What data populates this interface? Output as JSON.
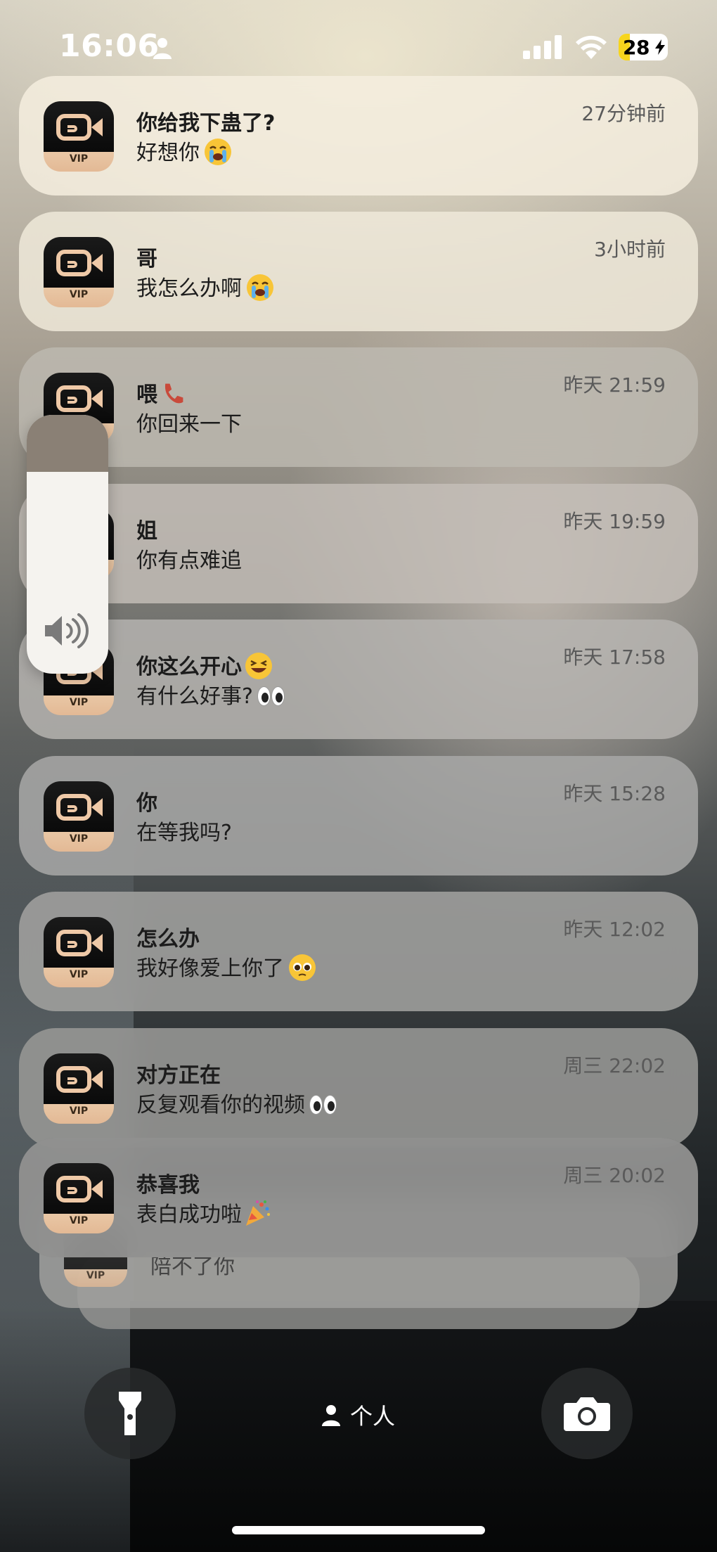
{
  "status_bar": {
    "time": "16:06",
    "battery": "28"
  },
  "notifications": [
    {
      "title": "你给我下蛊了?",
      "body": "好想你",
      "emoji": "crying",
      "time": "27分钟前"
    },
    {
      "title": "哥",
      "body": "我怎么办啊",
      "emoji": "crying",
      "time": "3小时前"
    },
    {
      "title": "喂",
      "body": "你回来一下",
      "title_emoji": "phone",
      "time": "昨天 21:59"
    },
    {
      "title": "姐",
      "body": "你有点难追",
      "time": "昨天 19:59"
    },
    {
      "title": "你这么开心",
      "body": "有什么好事?",
      "title_emoji": "laughing",
      "body_emoji": "eyes",
      "time": "昨天 17:58"
    },
    {
      "title": "你",
      "body": "在等我吗?",
      "time": "昨天 15:28"
    },
    {
      "title": "怎么办",
      "body": "我好像爱上你了",
      "emoji": "pleading",
      "time": "昨天 12:02"
    },
    {
      "title": "对方正在",
      "body": "反复观看你的视频",
      "body_emoji": "eyes",
      "time": "周三 22:02"
    },
    {
      "title": "恭喜我",
      "body": "表白成功啦",
      "body_emoji": "party-popper",
      "time": "周三 20:02"
    }
  ],
  "stacked_preview": {
    "body": "陪不了你"
  },
  "app_badge": "VIP",
  "volume": {
    "level": 0.78
  },
  "bottom": {
    "flashlight_icon": "flashlight-icon",
    "focus_label": "个人",
    "camera_icon": "camera-icon"
  },
  "colors": {
    "notif_light": "#f0ead8",
    "notif_grey": "#a8a49c",
    "icon_accent": "#efc9a7"
  }
}
